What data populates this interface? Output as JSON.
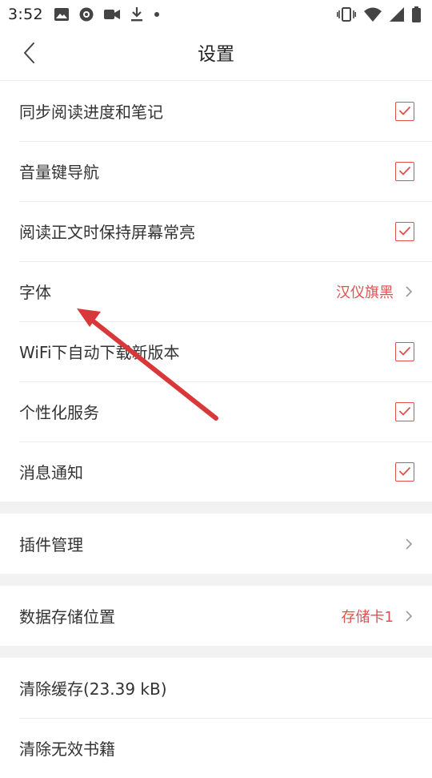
{
  "status_bar": {
    "time": "3:52",
    "left_icons": [
      "image-icon",
      "record-icon",
      "video-camera-icon",
      "download-icon",
      "dot-icon"
    ],
    "right_icons": [
      "vibrate-icon",
      "wifi-icon",
      "signal-icon",
      "battery-icon"
    ]
  },
  "header": {
    "title": "设置"
  },
  "groups": [
    {
      "items": [
        {
          "label": "同步阅读进度和笔记",
          "type": "checkbox",
          "checked": true
        },
        {
          "label": "音量键导航",
          "type": "checkbox",
          "checked": true
        },
        {
          "label": "阅读正文时保持屏幕常亮",
          "type": "checkbox",
          "checked": true
        },
        {
          "label": "字体",
          "type": "link",
          "value": "汉仪旗黑"
        },
        {
          "label": "WiFi下自动下载新版本",
          "type": "checkbox",
          "checked": true
        },
        {
          "label": "个性化服务",
          "type": "checkbox",
          "checked": true
        },
        {
          "label": "消息通知",
          "type": "checkbox",
          "checked": true
        }
      ]
    },
    {
      "items": [
        {
          "label": "插件管理",
          "type": "link"
        }
      ]
    },
    {
      "items": [
        {
          "label": "数据存储位置",
          "type": "link",
          "value": "存储卡1"
        }
      ]
    },
    {
      "items": [
        {
          "label": "清除缓存(23.39 kB)",
          "type": "action"
        },
        {
          "label": "清除无效书籍",
          "type": "action"
        }
      ]
    }
  ],
  "colors": {
    "accent": "#e0504e",
    "divider": "#ececec",
    "group_gap": "#f2f2f2",
    "annotation_arrow": "#d9383a"
  }
}
